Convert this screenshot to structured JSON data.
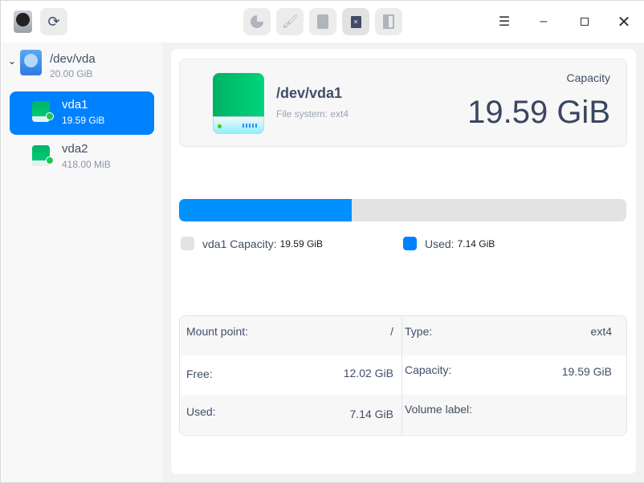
{
  "toolbar": {
    "icons": [
      "app-disk-icon",
      "refresh-icon",
      "partition-pie-icon",
      "wipe-brush-icon",
      "mount-icon",
      "delete-icon",
      "resize-icon"
    ],
    "window_controls": [
      "menu-icon",
      "minimize-icon",
      "maximize-icon",
      "close-icon"
    ]
  },
  "sidebar": {
    "disk": {
      "name": "/dev/vda",
      "size": "20.00 GiB"
    },
    "partitions": [
      {
        "name": "vda1",
        "size": "19.59 GiB",
        "selected": true
      },
      {
        "name": "vda2",
        "size": "418.00 MiB",
        "selected": false
      }
    ]
  },
  "summary": {
    "name": "/dev/vda1",
    "filesystem": "File system: ext4",
    "capacity_label": "Capacity",
    "capacity": "19.59 GiB"
  },
  "usage": {
    "used_fraction": 0.386,
    "capacity_label": "vda1 Capacity:",
    "capacity_value": "19.59 GiB",
    "used_label": "Used:",
    "used_value": "7.14 GiB",
    "colors": {
      "used": "#0091ff",
      "free": "#e3e3e3"
    }
  },
  "details": {
    "left": [
      {
        "label": "Mount point:",
        "value": "/"
      },
      {
        "label": "Free:",
        "value": "12.02 GiB"
      },
      {
        "label": "Used:",
        "value": "7.14 GiB"
      }
    ],
    "right": [
      {
        "label": "Type:",
        "value": "ext4"
      },
      {
        "label": "Capacity:",
        "value": "19.59 GiB"
      },
      {
        "label": "Volume label:",
        "value": ""
      }
    ]
  }
}
